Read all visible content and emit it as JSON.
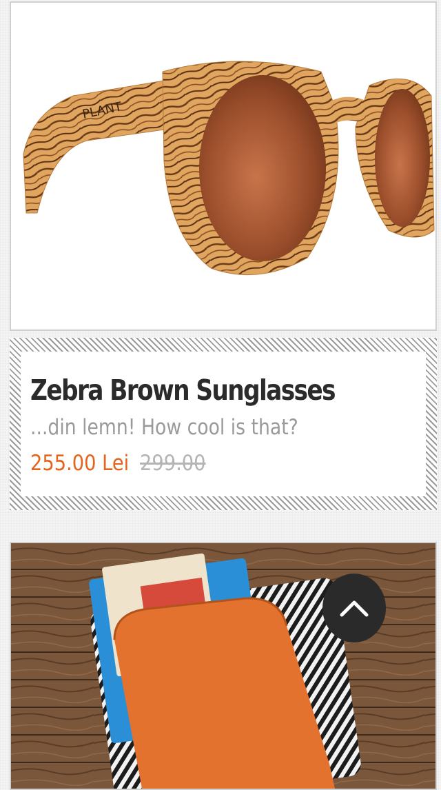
{
  "product": {
    "title": "Zebra Brown Sunglasses",
    "description": "...din lemn! How cool is that?",
    "price_current": "255.00 Lei",
    "price_old": "299.00",
    "brand_mark": "PLANT",
    "image_icon": "sunglasses-photo"
  },
  "next_product": {
    "image_icon": "wallet-photo"
  },
  "scroll_top": {
    "icon": "chevron-up-icon"
  },
  "colors": {
    "price": "#e4631d",
    "old_price": "#b4b4b4",
    "title": "#2b2b2b",
    "description": "#9a9a9a",
    "button": "#2a2a2a"
  }
}
